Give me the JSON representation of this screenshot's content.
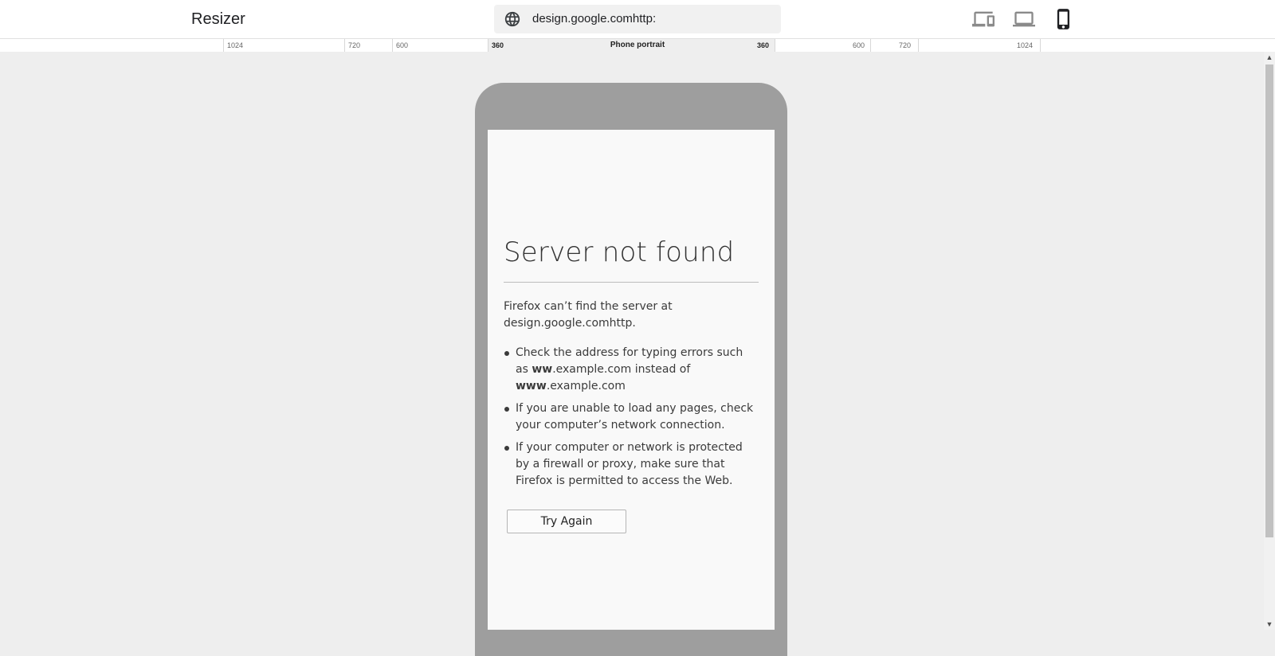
{
  "app": {
    "title": "Resizer"
  },
  "url_bar": {
    "value": "design.google.comhttp:",
    "icon": "globe-icon"
  },
  "devices": [
    {
      "name": "responsive-devices",
      "icon": "devices-icon",
      "active": false
    },
    {
      "name": "laptop",
      "icon": "laptop-icon",
      "active": false
    },
    {
      "name": "phone",
      "icon": "phone-icon",
      "active": true
    }
  ],
  "ruler": {
    "mode_label": "Phone portrait",
    "left_ticks": [
      "1024",
      "720",
      "600",
      "360"
    ],
    "right_ticks": [
      "360",
      "600",
      "720",
      "1024"
    ]
  },
  "error_page": {
    "title": "Server not found",
    "message": "Firefox can’t find the server at design.google.comhttp.",
    "tips": {
      "tip1_pre": "Check the address for typing errors such as ",
      "tip1_bold1": "ww",
      "tip1_mid1": ".example.com instead of ",
      "tip1_bold2": "www",
      "tip1_mid2": ".example.com",
      "tip2": "If you are unable to load any pages, check your computer’s network connection.",
      "tip3": "If your computer or network is protected by a firewall or proxy, make sure that Firefox is permitted to access the Web."
    },
    "button_label": "Try Again"
  },
  "colors": {
    "frame": "#9e9e9e",
    "stage": "#eeeeee",
    "active_icon": "#202124",
    "inactive_icon": "#8a8a8a"
  }
}
